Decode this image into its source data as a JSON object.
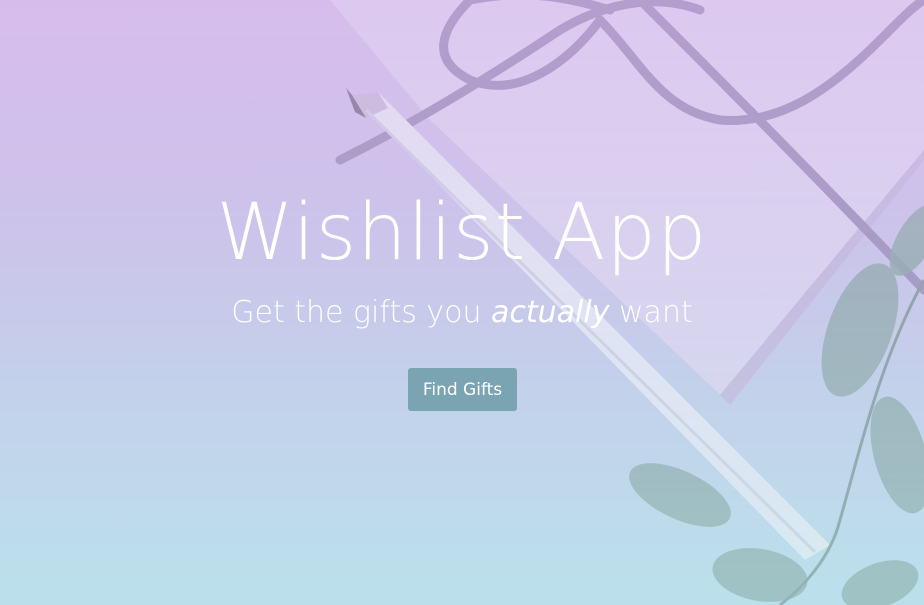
{
  "hero": {
    "title": "Wishlist App",
    "tagline": {
      "prefix": "Get the gifts you ",
      "emphasis": "actually",
      "suffix": " want"
    },
    "cta_label": "Find Gifts"
  },
  "colors": {
    "button": "#7aa4b2",
    "text": "#ffffff",
    "overlay_top": "#d8c4ec",
    "overlay_bottom": "#bfe0ec"
  },
  "background": {
    "objects": [
      "gift-box-with-ribbon",
      "pencil",
      "eucalyptus-leaves"
    ]
  }
}
